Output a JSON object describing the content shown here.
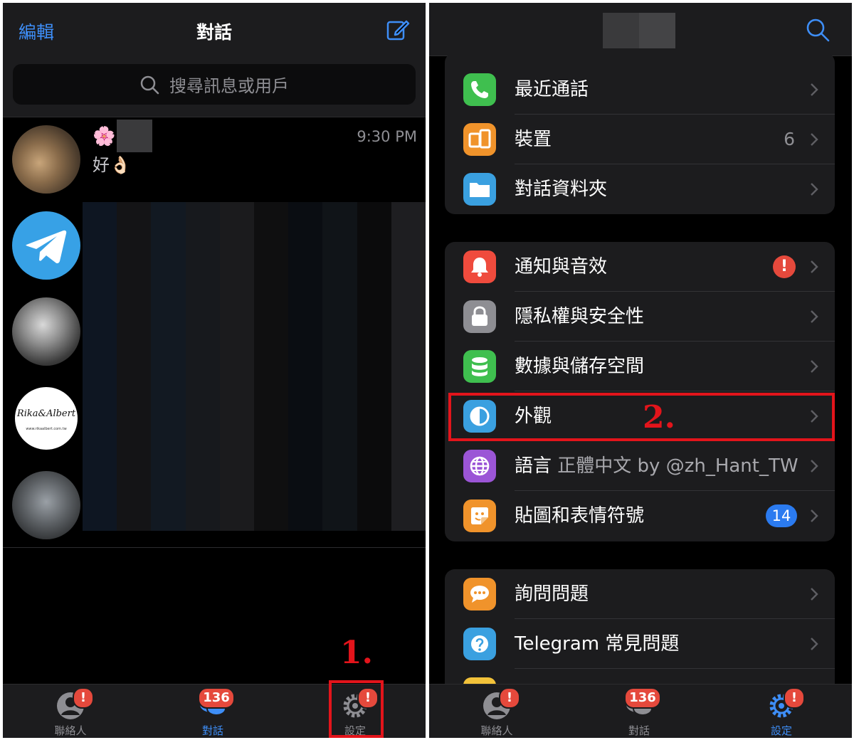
{
  "left": {
    "nav": {
      "edit": "編輯",
      "title": "對話"
    },
    "search": {
      "placeholder": "搜尋訊息或用戶"
    },
    "chats": [
      {
        "emoji": "🌸",
        "time": "9:30 PM",
        "message": "好👌🏻"
      },
      {
        "avatar_text": "Rika&Albert",
        "avatar_subtext": "www.rikaalbert.com.tw"
      }
    ],
    "tabs": {
      "contacts": {
        "label": "聯絡人",
        "badge": "!"
      },
      "chats": {
        "label": "對話",
        "badge": "136"
      },
      "settings": {
        "label": "設定",
        "badge": "!"
      }
    },
    "step": "1."
  },
  "right": {
    "groups": [
      {
        "rows": [
          {
            "label": "最近通話",
            "icon": "phone-icon",
            "color": "#3fbf4f"
          },
          {
            "label": "裝置",
            "icon": "devices-icon",
            "color": "#f0932b",
            "value": "6"
          },
          {
            "label": "對話資料夾",
            "icon": "folder-icon",
            "color": "#3aa0e0"
          }
        ]
      },
      {
        "rows": [
          {
            "label": "通知與音效",
            "icon": "bell-icon",
            "color": "#ef4b3d",
            "badge": "!"
          },
          {
            "label": "隱私權與安全性",
            "icon": "lock-icon",
            "color": "#8e8e93"
          },
          {
            "label": "數據與儲存空間",
            "icon": "database-icon",
            "color": "#3fbf4f"
          },
          {
            "label": "外觀",
            "icon": "appearance-icon",
            "color": "#3aa0e0"
          },
          {
            "label": "語言",
            "sub": "正體中文 by @zh_Hant_TW",
            "icon": "globe-icon",
            "color": "#9b55d6"
          },
          {
            "label": "貼圖和表情符號",
            "icon": "sticker-icon",
            "color": "#f0932b",
            "badge": "14"
          }
        ]
      },
      {
        "rows": [
          {
            "label": "詢問問題",
            "icon": "chat-bubble-icon",
            "color": "#f0932b"
          },
          {
            "label": "Telegram 常見問題",
            "icon": "question-icon",
            "color": "#3aa0e0"
          }
        ]
      }
    ],
    "tabs": {
      "contacts": {
        "label": "聯絡人",
        "badge": "!"
      },
      "chats": {
        "label": "對話",
        "badge": "136"
      },
      "settings": {
        "label": "設定",
        "badge": "!"
      }
    },
    "step": "2."
  },
  "colors": {
    "accent": "#3e8ef7",
    "badge": "#e5493c",
    "highlight": "#e3141b"
  }
}
